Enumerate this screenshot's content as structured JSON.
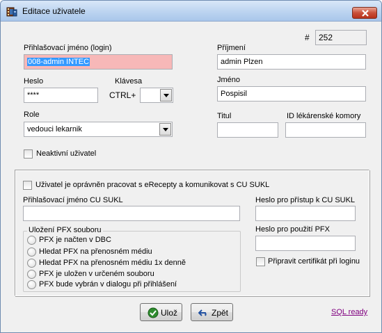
{
  "window": {
    "title": "Editace uživatele"
  },
  "form": {
    "id_hash_label": "#",
    "id_value": "252",
    "login_label": "Přihlašovací jméno (login)",
    "login_value": "008-admin INTEC",
    "surname_label": "Příjmení",
    "surname_value": "admin Plzen",
    "password_label": "Heslo",
    "password_value": "****",
    "hotkey_label": "Klávesa",
    "hotkey_prefix": "CTRL+",
    "hotkey_value": "",
    "name_label": "Jméno",
    "name_value": "Pospisil",
    "role_label": "Role",
    "role_value": "vedouci lekarnik",
    "title_label": "Titul",
    "title_value": "",
    "pharmacy_id_label": "ID lékárenské komory",
    "pharmacy_id_value": "",
    "inactive_label": "Neaktivní uživatel"
  },
  "sukl": {
    "erecept_label": "Uživatel je oprávněn pracovat s eRecepty a komunikovat s CU SUKL",
    "login_label": "Přihlašovací jméno CU SUKL",
    "login_value": "",
    "access_password_label": "Heslo pro přístup k CU SUKL",
    "access_password_value": "",
    "pfx_password_label": "Heslo pro použití PFX",
    "pfx_password_value": "",
    "prepare_cert_label": "Připravit certifikát při loginu",
    "pfx_group": {
      "caption": "Uložení PFX souboru",
      "options": [
        "PFX je načten v DBC",
        "Hledat PFX na přenosném médiu",
        "Hledat PFX na přenosném médiu 1x denně",
        "PFX je uložen v určeném souboru",
        "PFX bude vybrán v dialogu při přihlášení"
      ]
    }
  },
  "footer": {
    "save_label": "Ulož",
    "back_label": "Zpět",
    "sql_status": "SQL ready"
  },
  "colors": {
    "login_bg": "#f7b8b8",
    "selection": "#3399ff",
    "link": "#800080",
    "close_red": "#c9503a"
  }
}
